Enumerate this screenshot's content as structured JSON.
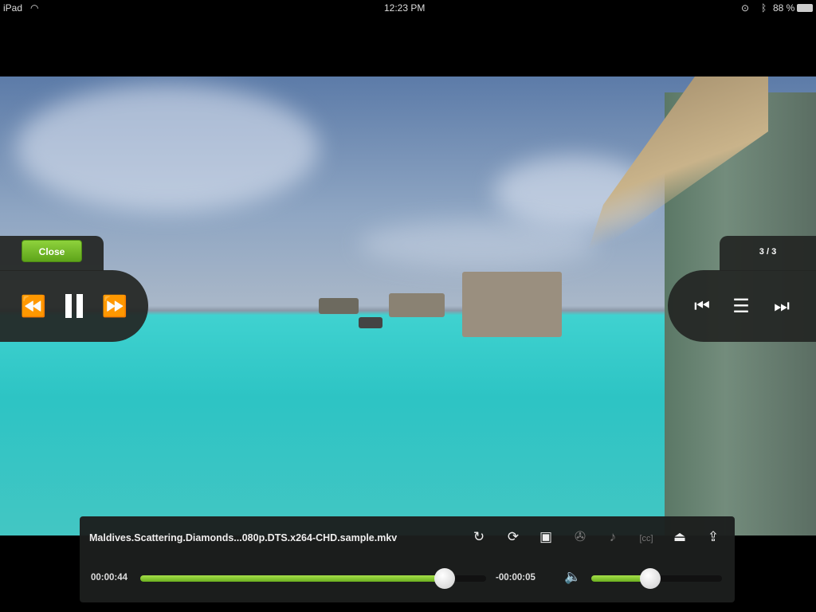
{
  "status_bar": {
    "device": "iPad",
    "wifi_icon": "wifi-icon",
    "time": "12:23 PM",
    "battery": "88 %"
  },
  "left_panel": {
    "close_label": "Close"
  },
  "right_panel": {
    "counter": "3 / 3"
  },
  "bottom_bar": {
    "filename": "Maldives.Scattering.Diamonds...080p.DTS.x264-CHD.sample.mkv",
    "elapsed": "00:00:44",
    "remaining": "-00:00:05",
    "progress": 0.88,
    "volume": 0.45,
    "accent": "#7bc52a"
  }
}
